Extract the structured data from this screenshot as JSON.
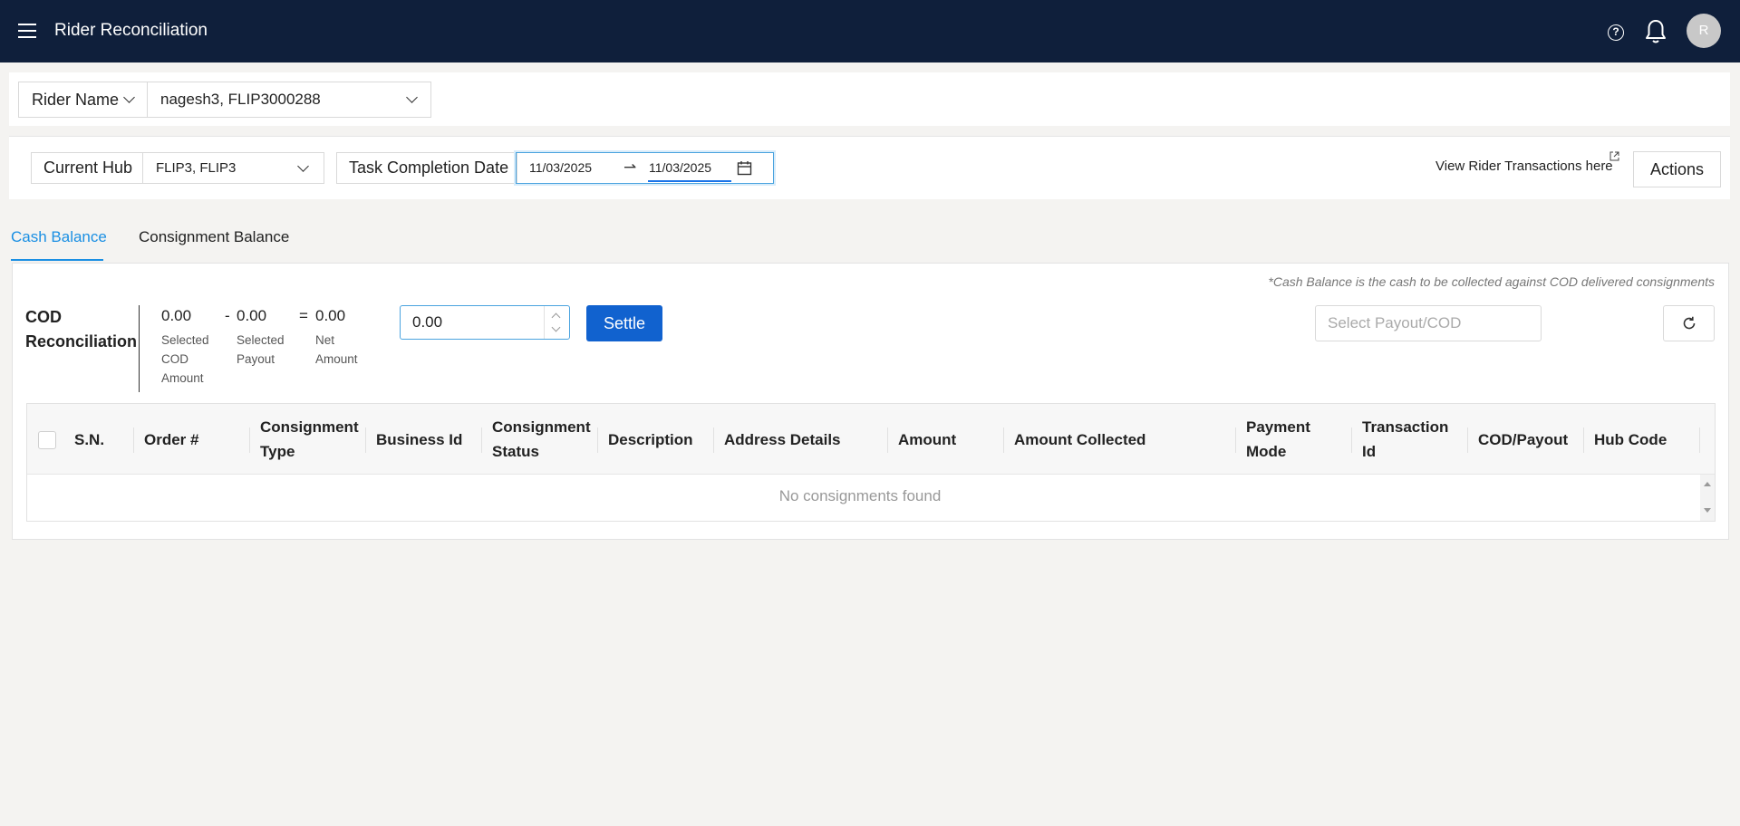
{
  "header": {
    "title": "Rider Reconciliation",
    "avatar_initial": "R",
    "icons": [
      "menu-icon",
      "help-icon",
      "bell-icon"
    ]
  },
  "rider": {
    "label": "Rider Name",
    "value": "nagesh3, FLIP3000288"
  },
  "filters": {
    "hub_label": "Current Hub",
    "hub_value": "FLIP3, FLIP3",
    "date_label": "Task Completion Date",
    "date_start": "11/03/2025",
    "date_end": "11/03/2025",
    "view_link": "View Rider Transactions here",
    "actions_label": "Actions"
  },
  "tabs": [
    {
      "label": "Cash Balance",
      "active": true
    },
    {
      "label": "Consignment Balance",
      "active": false
    }
  ],
  "cash": {
    "note": "*Cash Balance is the cash to be collected against COD delivered consignments",
    "title": "COD Reconciliation",
    "selected_cod": {
      "value": "0.00",
      "label": "Selected COD Amount"
    },
    "minus": "-",
    "selected_payout": {
      "value": "0.00",
      "label": "Selected Payout"
    },
    "equals": "=",
    "net": {
      "value": "0.00",
      "label": "Net Amount"
    },
    "amount_input_value": "0.00",
    "settle_label": "Settle",
    "payout_placeholder": "Select Payout/COD"
  },
  "table": {
    "columns": [
      "S.N.",
      "Order #",
      "Consignment Type",
      "Business Id",
      "Consignment Status",
      "Description",
      "Address Details",
      "Amount",
      "Amount Collected",
      "Payment Mode",
      "Transaction Id",
      "COD/Payout",
      "Hub Code"
    ],
    "empty_text": "No consignments found"
  },
  "colors": {
    "header_bg": "#0f1f3b",
    "accent": "#1a8fe3",
    "settle_bg": "#1162cf"
  }
}
